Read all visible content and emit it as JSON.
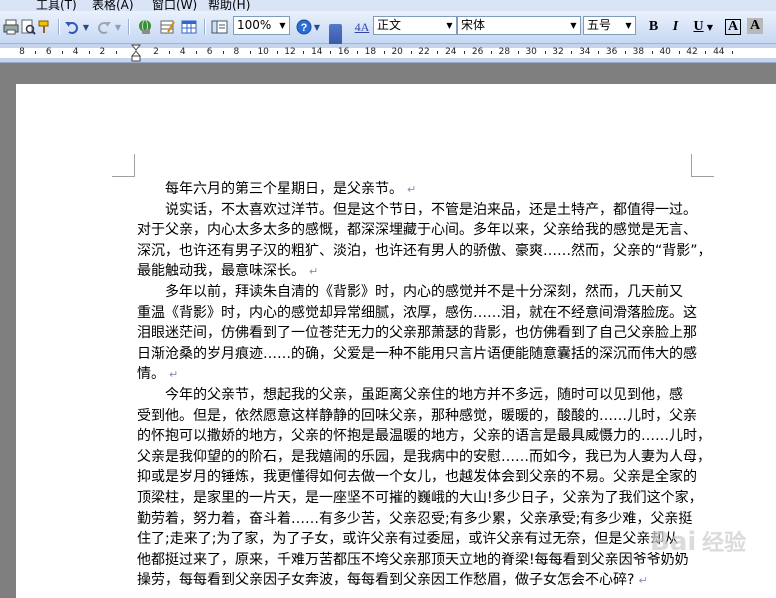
{
  "menubar": {
    "items": [
      "工具(T)",
      "表格(A)",
      "窗口(W)",
      "帮助(H)"
    ]
  },
  "toolbar": {
    "zoom_value": "100%",
    "style_value": "正文",
    "font_value": "宋体",
    "size_value": "五号",
    "bold_label": "B",
    "italic_label": "I",
    "underline_label": "U",
    "style_icon_label": "4A",
    "charborder_label": "A",
    "charshade_label": "A"
  },
  "ruler": {
    "labels": [
      "8",
      "6",
      "4",
      "2",
      "2",
      "4",
      "6",
      "8",
      "10",
      "12",
      "14",
      "16",
      "18",
      "20",
      "22",
      "24",
      "26",
      "28",
      "30",
      "32",
      "34",
      "36",
      "38",
      "40",
      "42",
      "44"
    ]
  },
  "document": {
    "lines": [
      "每年六月的第三个星期日，是父亲节。",
      "说实话，不太喜欢过洋节。但是这个节日，不管是泊来品，还是土特产，都值得一过。",
      "对于父亲，内心太多太多的感慨，都深深埋藏于心间。多年以来，父亲给我的感觉是无言、",
      "深沉，也许还有男子汉的粗犷、淡泊，也许还有男人的骄傲、豪爽……然而，父亲的“背影”，",
      "最能触动我，最意味深长。",
      "多年以前，拜读朱自清的《背影》时，内心的感觉并不是十分深刻，然而，几天前又",
      "重温《背影》时，内心的感觉却异常细腻，浓厚，感伤……泪，就在不经意间滑落脸庞。这",
      "泪眼迷茫间，仿佛看到了一位苍茫无力的父亲那萧瑟的背影，也仿佛看到了自己父亲脸上那",
      "日渐沧桑的岁月痕迹……的确，父爱是一种不能用只言片语便能随意囊括的深沉而伟大的感",
      "情。",
      "今年的父亲节，想起我的父亲，虽距离父亲住的地方并不多远，随时可以见到他，感",
      "受到他。但是，依然愿意这样静静的回味父亲，那种感觉，暖暖的，酸酸的……儿时，父亲",
      "的怀抱可以撒娇的地方，父亲的怀抱是最温暖的地方，父亲的语言是最具威慑力的……儿时，",
      "父亲是我仰望的的阶石，是我嬉闹的乐园，是我病中的安慰……而如今，我已为人妻为人母，",
      "抑或是岁月的锤炼，我更懂得如何去做一个女儿，也越发体会到父亲的不易。父亲是全家的",
      "顶梁柱，是家里的一片天，是一座坚不可摧的巍峨的大山!多少日子，父亲为了我们这个家，",
      "勤劳着，努力着，奋斗着……有多少苦，父亲忍受;有多少累，父亲承受;有多少难，父亲挺",
      "住了;走来了;为了家，为了子女，或许父亲有过委屈，或许父亲有过无奈，但是父亲却从",
      "他都挺过来了，原来，千难万苦都压不垮父亲那顶天立地的脊梁!每每看到父亲因爷爷奶奶",
      "操劳，每每看到父亲因子女奔波，每每看到父亲因工作愁眉，做子女怎会不心碎?"
    ],
    "indented_lines": [
      1,
      5,
      10
    ],
    "paragraph_end_lines": [
      0,
      4,
      9,
      19
    ]
  }
}
